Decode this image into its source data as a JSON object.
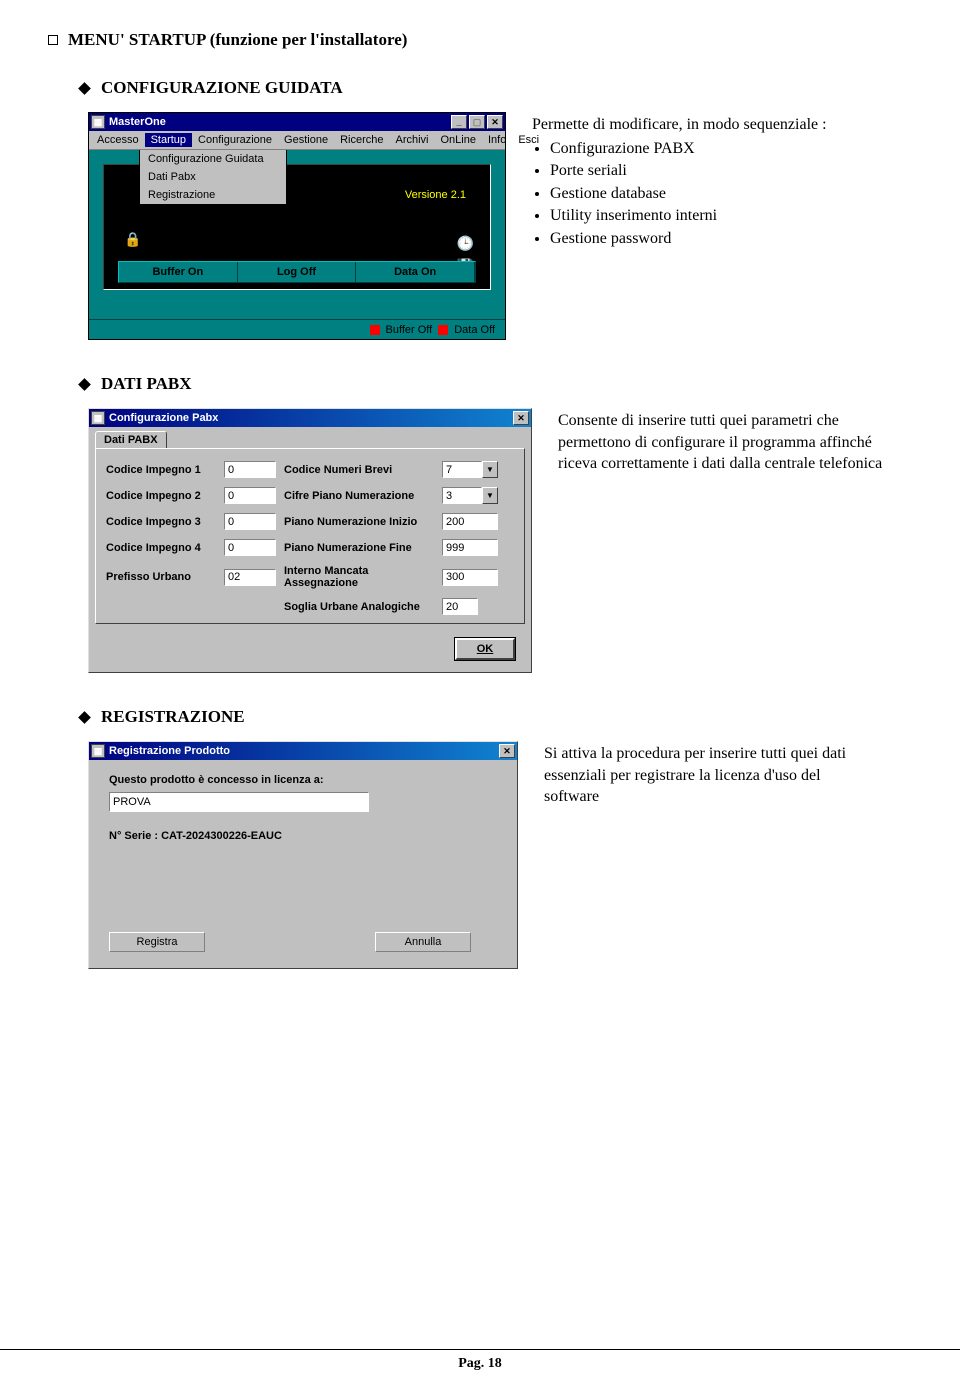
{
  "heading1": "MENU' STARTUP  (funzione per l'installatore)",
  "sec1": {
    "title": "CONFIGURAZIONE GUIDATA",
    "desc_lead": "Permette di modificare, in modo sequenziale :",
    "bullets": [
      "Configurazione PABX",
      "Porte seriali",
      "Gestione database",
      "Utility inserimento interni",
      "Gestione password"
    ]
  },
  "masterone": {
    "title": "MasterOne",
    "menu": [
      "Accesso",
      "Startup",
      "Configurazione",
      "Gestione",
      "Ricerche",
      "Archivi",
      "OnLine",
      "Info",
      "Esci"
    ],
    "dropdown": [
      "Configurazione Guidata",
      "Dati Pabx",
      "Registrazione"
    ],
    "version": "Versione 2.1",
    "btns": [
      "Buffer On",
      "Log Off",
      "Data On"
    ],
    "status": {
      "left": "Buffer Off",
      "right": "Data Off"
    }
  },
  "sec2": {
    "title": "DATI PABX",
    "desc": "Consente di inserire tutti quei parametri che permettono di configurare il programma affinché riceva correttamente i dati dalla centrale telefonica"
  },
  "pabx": {
    "title": "Configurazione Pabx",
    "tab": "Dati PABX",
    "labels": {
      "c1": "Codice Impegno 1",
      "c2": "Codice Impegno 2",
      "c3": "Codice Impegno 3",
      "c4": "Codice Impegno 4",
      "pu": "Prefisso Urbano",
      "cnb": "Codice Numeri Brevi",
      "cpn": "Cifre Piano Numerazione",
      "pni": "Piano Numerazione Inizio",
      "pnf": "Piano Numerazione Fine",
      "ima": "Interno Mancata Assegnazione",
      "sua": "Soglia Urbane Analogiche"
    },
    "values": {
      "c1": "0",
      "c2": "0",
      "c3": "0",
      "c4": "0",
      "pu": "02",
      "cnb": "7",
      "cpn": "3",
      "pni": "200",
      "pnf": "999",
      "ima": "300",
      "sua": "20"
    },
    "ok": "OK"
  },
  "sec3": {
    "title": "REGISTRAZIONE",
    "desc": "Si attiva la procedura per inserire tutti quei dati essenziali per registrare la licenza d'uso del software"
  },
  "reg": {
    "title": "Registrazione Prodotto",
    "license_lbl": "Questo prodotto è concesso in licenza a:",
    "license_val": "PROVA",
    "serial_lbl": "N° Serie : CAT-2024300226-EAUC",
    "btn_reg": "Registra",
    "btn_ann": "Annulla"
  },
  "footer": "Pag. 18"
}
